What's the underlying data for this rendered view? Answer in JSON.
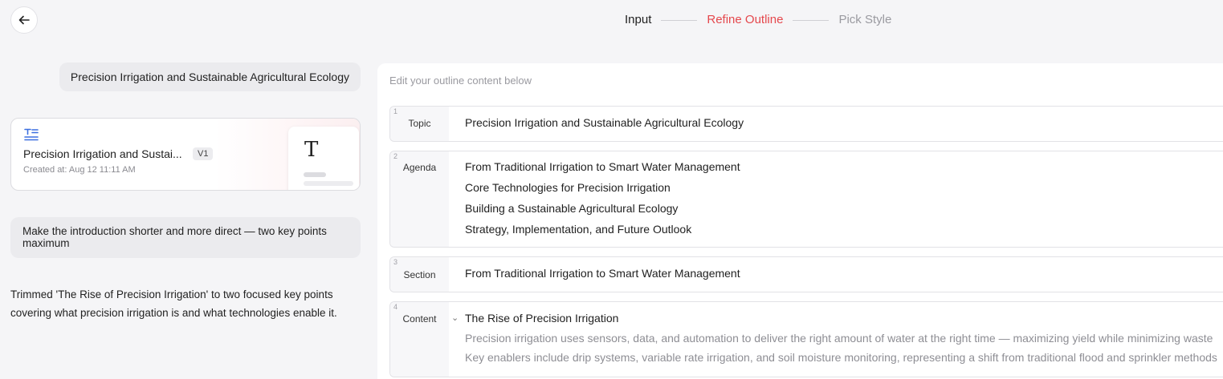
{
  "stepper": {
    "steps": [
      {
        "label": "Input",
        "state": "done"
      },
      {
        "label": "Refine Outline",
        "state": "active"
      },
      {
        "label": "Pick Style",
        "state": "todo"
      }
    ]
  },
  "chat": {
    "user_topic": "Precision Irrigation and Sustainable Agricultural Ecology",
    "doc_card": {
      "title": "Precision Irrigation and Sustai...",
      "version": "V1",
      "created": "Created at: Aug 12 11:11 AM",
      "thumb_letter": "T"
    },
    "user_request": "Make the introduction shorter and more direct — two key points maximum",
    "assistant_reply": "Trimmed 'The Rise of Precision Irrigation' to two focused key points covering what precision irrigation is and what technologies enable it."
  },
  "outline": {
    "hint": "Edit your outline content below",
    "rows": [
      {
        "num": "1",
        "label": "Topic",
        "lines": [
          "Precision Irrigation and Sustainable Agricultural Ecology"
        ]
      },
      {
        "num": "2",
        "label": "Agenda",
        "lines": [
          "From Traditional Irrigation to Smart Water Management",
          "Core Technologies for Precision Irrigation",
          "Building a Sustainable Agricultural Ecology",
          "Strategy, Implementation, and Future Outlook"
        ]
      },
      {
        "num": "3",
        "label": "Section",
        "lines": [
          "From Traditional Irrigation to Smart Water Management"
        ]
      },
      {
        "num": "4",
        "label": "Content",
        "title": "The Rise of Precision Irrigation",
        "sub": [
          "Precision irrigation uses sensors, data, and automation to deliver the right amount of water at the right time — maximizing yield while minimizing waste",
          "Key enablers include drip systems, variable rate irrigation, and soil moisture monitoring, representing a shift from traditional flood and sprinkler methods"
        ]
      }
    ]
  },
  "colors": {
    "active_step": "#e5484d",
    "accent_icon": "#3b6fe0"
  },
  "icons": {
    "back": "arrow-left-icon",
    "doc": "text-format-icon",
    "collapse": "chevron-down-icon"
  }
}
